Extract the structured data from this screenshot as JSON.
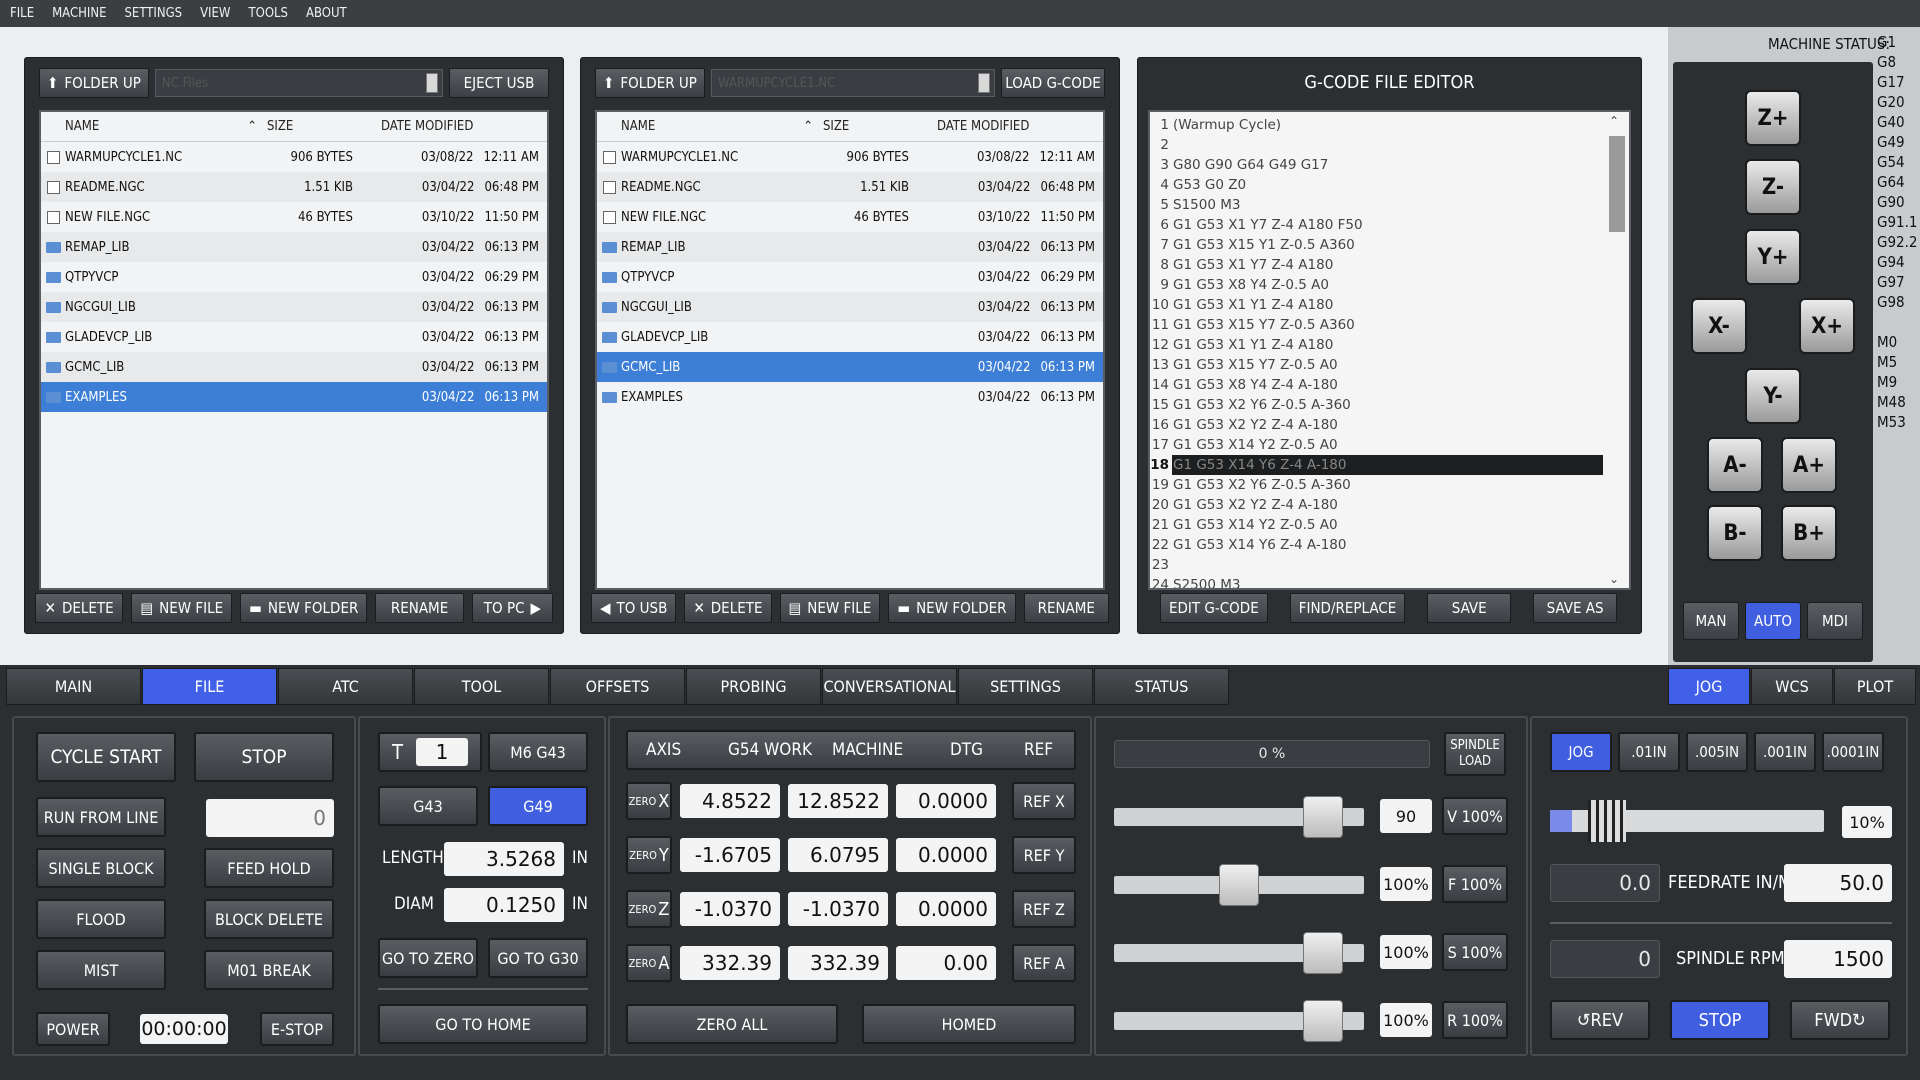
{
  "menu": [
    "FILE",
    "MACHINE",
    "SETTINGS",
    "VIEW",
    "TOOLS",
    "ABOUT"
  ],
  "file_browser_left": {
    "folder_up": "FOLDER UP",
    "path_placeholder": "NC Files",
    "eject": "EJECT USB",
    "headers": {
      "name": "NAME",
      "size": "SIZE",
      "date": "DATE MODIFIED"
    },
    "rows": [
      {
        "name": "WARMUPCYCLE1.NC",
        "size": "906 BYTES",
        "date": "03/08/22",
        "time": "12:11 AM",
        "type": "file"
      },
      {
        "name": "README.NGC",
        "size": "1.51 KIB",
        "date": "03/04/22",
        "time": "06:48 PM",
        "type": "file"
      },
      {
        "name": "NEW FILE.NGC",
        "size": "46 BYTES",
        "date": "03/10/22",
        "time": "11:50 PM",
        "type": "file"
      },
      {
        "name": "REMAP_LIB",
        "size": "",
        "date": "03/04/22",
        "time": "06:13 PM",
        "type": "folder"
      },
      {
        "name": "QTPYVCP",
        "size": "",
        "date": "03/04/22",
        "time": "06:29 PM",
        "type": "folder"
      },
      {
        "name": "NGCGUI_LIB",
        "size": "",
        "date": "03/04/22",
        "time": "06:13 PM",
        "type": "folder"
      },
      {
        "name": "GLADEVCP_LIB",
        "size": "",
        "date": "03/04/22",
        "time": "06:13 PM",
        "type": "folder"
      },
      {
        "name": "GCMC_LIB",
        "size": "",
        "date": "03/04/22",
        "time": "06:13 PM",
        "type": "folder"
      },
      {
        "name": "EXAMPLES",
        "size": "",
        "date": "03/04/22",
        "time": "06:13 PM",
        "type": "folder"
      }
    ],
    "selected": 8,
    "footer": [
      "DELETE",
      "NEW FILE",
      "NEW FOLDER",
      "RENAME",
      "TO PC"
    ]
  },
  "file_browser_right": {
    "folder_up": "FOLDER UP",
    "path_placeholder": "WARMUPCYCLE1.NC",
    "load": "LOAD G-CODE",
    "headers": {
      "name": "NAME",
      "size": "SIZE",
      "date": "DATE MODIFIED"
    },
    "rows": [
      {
        "name": "WARMUPCYCLE1.NC",
        "size": "906 BYTES",
        "date": "03/08/22",
        "time": "12:11 AM",
        "type": "file"
      },
      {
        "name": "README.NGC",
        "size": "1.51 KIB",
        "date": "03/04/22",
        "time": "06:48 PM",
        "type": "file"
      },
      {
        "name": "NEW FILE.NGC",
        "size": "46 BYTES",
        "date": "03/10/22",
        "time": "11:50 PM",
        "type": "file"
      },
      {
        "name": "REMAP_LIB",
        "size": "",
        "date": "03/04/22",
        "time": "06:13 PM",
        "type": "folder"
      },
      {
        "name": "QTPYVCP",
        "size": "",
        "date": "03/04/22",
        "time": "06:29 PM",
        "type": "folder"
      },
      {
        "name": "NGCGUI_LIB",
        "size": "",
        "date": "03/04/22",
        "time": "06:13 PM",
        "type": "folder"
      },
      {
        "name": "GLADEVCP_LIB",
        "size": "",
        "date": "03/04/22",
        "time": "06:13 PM",
        "type": "folder"
      },
      {
        "name": "GCMC_LIB",
        "size": "",
        "date": "03/04/22",
        "time": "06:13 PM",
        "type": "folder"
      },
      {
        "name": "EXAMPLES",
        "size": "",
        "date": "03/04/22",
        "time": "06:13 PM",
        "type": "folder"
      }
    ],
    "selected": 7,
    "footer": [
      "TO USB",
      "DELETE",
      "NEW FILE",
      "NEW FOLDER",
      "RENAME"
    ]
  },
  "gcode_editor": {
    "title": "G-CODE FILE EDITOR",
    "lines": [
      "(Warmup Cycle)",
      "",
      "G80 G90 G64 G49 G17",
      "G53 G0 Z0",
      "S1500 M3",
      "G1 G53 X1 Y7 Z-4 A180 F50",
      "G1 G53 X15 Y1 Z-0.5 A360",
      "G1 G53 X1 Y7 Z-4 A180",
      "G1 G53 X8 Y4 Z-0.5 A0",
      "G1 G53 X1 Y1 Z-4 A180",
      "G1 G53 X15 Y7 Z-0.5 A360",
      "G1 G53 X1 Y1 Z-4 A180",
      "G1 G53 X15 Y7 Z-0.5 A0",
      "G1 G53 X8 Y4 Z-4 A-180",
      "G1 G53 X2 Y6 Z-0.5 A-360",
      "G1 G53 X2 Y2 Z-4 A-180",
      "G1 G53 X14 Y2 Z-0.5 A0",
      "G1 G53 X14 Y6 Z-4 A-180",
      "G1 G53 X2 Y6 Z-0.5 A-360",
      "G1 G53 X2 Y2 Z-4 A-180",
      "G1 G53 X14 Y2 Z-0.5 A0",
      "G1 G53 X14 Y6 Z-4 A-180",
      "",
      "S2500 M3"
    ],
    "highlight_line": 18,
    "buttons": [
      "EDIT G-CODE",
      "FIND/REPLACE",
      "SAVE",
      "SAVE AS"
    ]
  },
  "machine_status": {
    "label": "MACHINE STATUS:",
    "gcodes": [
      "G1",
      "G8",
      "G17",
      "G20",
      "G40",
      "G49",
      "G54",
      "G64",
      "G90",
      "G91.1",
      "G92.2",
      "G94",
      "G97",
      "G98",
      "",
      "M0",
      "M5",
      "M9",
      "M48",
      "M53"
    ]
  },
  "jog_buttons": {
    "zp": "Z+",
    "zm": "Z-",
    "yp": "Y+",
    "xm": "X-",
    "xp": "X+",
    "ym": "Y-",
    "am": "A-",
    "ap": "A+",
    "bm": "B-",
    "bp": "B+"
  },
  "modes": {
    "man": "MAN",
    "auto": "AUTO",
    "mdi": "MDI",
    "active": "AUTO"
  },
  "tabs": [
    "MAIN",
    "FILE",
    "ATC",
    "TOOL",
    "OFFSETS",
    "PROBING",
    "CONVERSATIONAL",
    "SETTINGS",
    "STATUS"
  ],
  "active_tab": "FILE",
  "right_tabs": [
    "JOG",
    "WCS",
    "PLOT"
  ],
  "active_right_tab": "JOG",
  "program_control": {
    "cycle_start": "CYCLE START",
    "stop": "STOP",
    "run_from_line": "RUN FROM LINE",
    "line_value": "0",
    "single_block": "SINGLE BLOCK",
    "feed_hold": "FEED HOLD",
    "flood": "FLOOD",
    "block_delete": "BLOCK DELETE",
    "mist": "MIST",
    "m01_break": "M01 BREAK",
    "power": "POWER",
    "timer": "00:00:00",
    "estop": "E-STOP"
  },
  "tool_panel": {
    "t_label": "T",
    "t_value": "1",
    "m6g43": "M6 G43",
    "g43": "G43",
    "g49": "G49",
    "length_label": "LENGTH",
    "length_value": "3.5268",
    "length_unit": "IN",
    "diam_label": "DIAM",
    "diam_value": "0.1250",
    "diam_unit": "IN",
    "go_to_zero": "GO TO ZERO",
    "go_to_g30": "GO TO G30",
    "go_to_home": "GO TO HOME"
  },
  "dro": {
    "headers": [
      "AXIS",
      "G54 WORK",
      "MACHINE",
      "DTG",
      "REF"
    ],
    "rows": [
      {
        "zero": "ZERO",
        "axis": "X",
        "work": "4.8522",
        "machine": "12.8522",
        "dtg": "0.0000",
        "ref": "REF X"
      },
      {
        "zero": "ZERO",
        "axis": "Y",
        "work": "-1.6705",
        "machine": "6.0795",
        "dtg": "0.0000",
        "ref": "REF Y"
      },
      {
        "zero": "ZERO",
        "axis": "Z",
        "work": "-1.0370",
        "machine": "-1.0370",
        "dtg": "0.0000",
        "ref": "REF Z"
      },
      {
        "zero": "ZERO",
        "axis": "A",
        "work": "332.39",
        "machine": "332.39",
        "dtg": "0.00",
        "ref": "REF A"
      }
    ],
    "zero_all": "ZERO ALL",
    "homed": "HOMED"
  },
  "overrides": {
    "spindle_load_value": "0 %",
    "spindle_load_label": "SPINDLE LOAD",
    "rows": [
      {
        "value": "90",
        "button": "V 100%",
        "level": 0.9
      },
      {
        "value": "100%",
        "button": "F 100%",
        "level": 0.5
      },
      {
        "value": "100%",
        "button": "S 100%",
        "level": 0.9
      },
      {
        "value": "100%",
        "button": "R 100%",
        "level": 0.9
      }
    ]
  },
  "jog_control": {
    "increments": [
      "JOG",
      ".01IN",
      ".005IN",
      ".001IN",
      ".0001IN"
    ],
    "active_increment": "JOG",
    "jog_rate": "10%",
    "feed_actual": "0.0",
    "feed_label": "FEEDRATE IN/M",
    "feed_set": "50.0",
    "spindle_actual": "0",
    "spindle_label": "SPINDLE RPM",
    "spindle_set": "1500",
    "rev": "REV",
    "stop": "STOP",
    "fwd": "FWD"
  }
}
